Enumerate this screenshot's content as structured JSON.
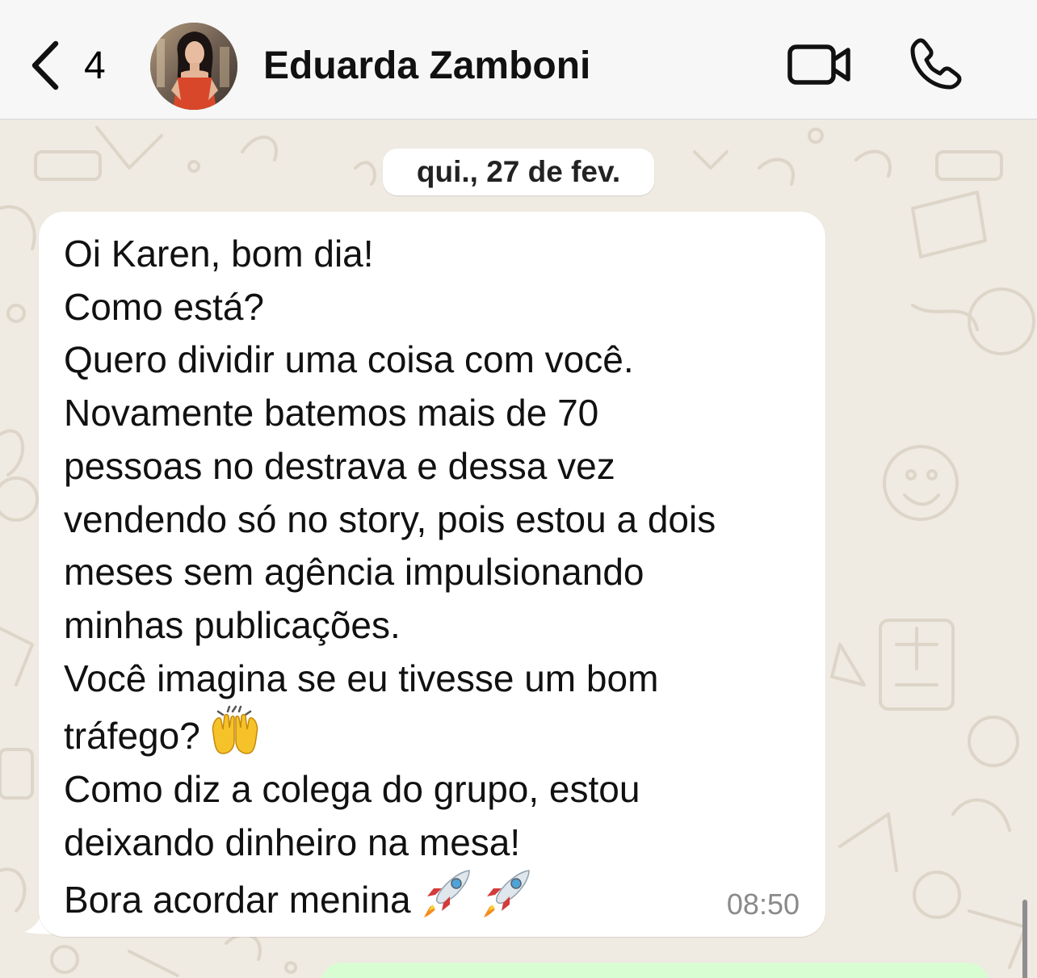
{
  "header": {
    "back_count": "4",
    "contact_name": "Eduarda Zamboni",
    "icons": {
      "back": "chevron-left-icon",
      "video": "video-camera-icon",
      "call": "phone-icon"
    }
  },
  "chat": {
    "date_separator": "qui., 27 de fev.",
    "message": {
      "lines": [
        "Oi Karen, bom dia!",
        "Como está?",
        "Quero dividir uma coisa com você.",
        "Novamente batemos mais de 70",
        "pessoas no destrava e dessa vez",
        "vendendo só no story, pois estou a dois",
        "meses sem agência impulsionando",
        "minhas publicações.",
        "Você imagina se eu tivesse um bom",
        "tráfego?",
        "Como diz a colega do grupo, estou",
        "deixando dinheiro na mesa!",
        "Bora acordar menina"
      ],
      "emojis": {
        "line_10": "raising-hands-emoji",
        "line_13": "rocket-emoji"
      },
      "time": "08:50"
    }
  },
  "colors": {
    "header_bg": "#f7f7f7",
    "wallpaper_bg": "#efeae2",
    "incoming_bubble": "#ffffff",
    "outgoing_bubble": "#d9fdd3",
    "timestamp": "#8a8a8a"
  }
}
